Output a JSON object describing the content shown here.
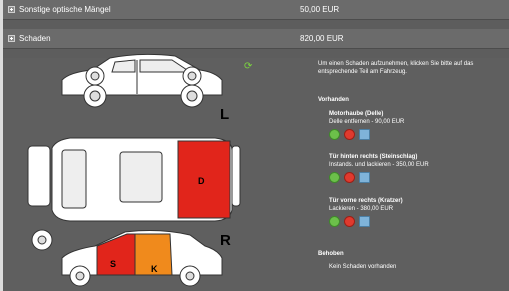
{
  "rows": [
    {
      "label": "Sonstige optische Mängel",
      "amount": "50,00 EUR"
    },
    {
      "label": "Schaden",
      "amount": "820,00 EUR"
    }
  ],
  "instruction": "Um einen Schaden aufzunehmen, klicken Sie bitte auf das entsprechende Teil am Fahrzeug.",
  "vorhanden_heading": "Vorhanden",
  "damages": [
    {
      "title": "Motorhaube (Delle)",
      "desc": "Delle entfernen - 90,00 EUR"
    },
    {
      "title": "Tür hinten rechts (Steinschlag)",
      "desc": "Instands. und lackieren - 350,00 EUR"
    },
    {
      "title": "Tür vorne rechts (Kratzer)",
      "desc": "Lackieren - 380,00 EUR"
    }
  ],
  "behoben_heading": "Behoben",
  "behoben_text": "Kein Schaden vorhanden",
  "letters": {
    "left": "L",
    "right": "R",
    "hood": "D",
    "rear_door": "S",
    "front_door": "K"
  },
  "icons": {
    "refresh": "refresh-icon",
    "approve": "check-icon",
    "delete": "delete-icon",
    "edit": "document-icon"
  },
  "colors": {
    "damage_red": "#e1251b",
    "damage_orange": "#f08a1c",
    "panel": "#5f5f5f",
    "car": "#ffffff"
  }
}
